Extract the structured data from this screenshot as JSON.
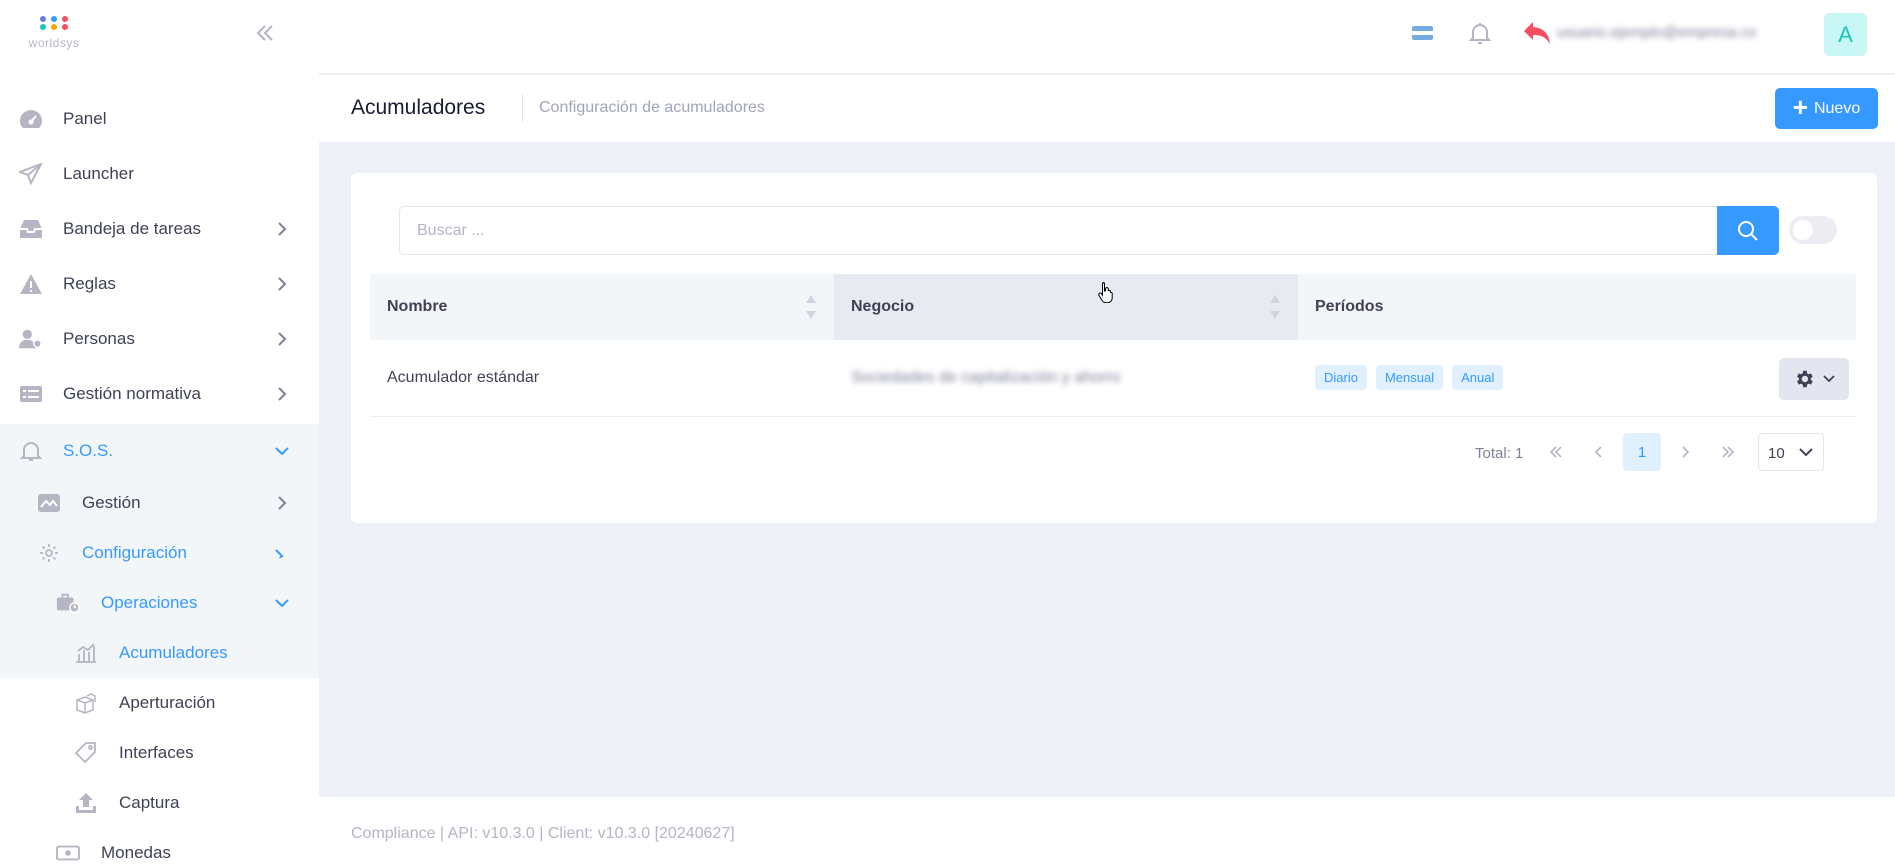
{
  "app": {
    "logo_text": "worldsys",
    "logo_colors": [
      "#6c7ae0",
      "#3699ff",
      "#f64e60",
      "#1bc5bd",
      "#ffa800"
    ]
  },
  "sidebar": {
    "items": [
      {
        "label": "Panel",
        "icon": "gauge-icon"
      },
      {
        "label": "Launcher",
        "icon": "paper-plane-icon"
      },
      {
        "label": "Bandeja de tareas",
        "icon": "inbox-tray-icon"
      },
      {
        "label": "Reglas",
        "icon": "warning-icon"
      },
      {
        "label": "Personas",
        "icon": "user-gear-icon"
      },
      {
        "label": "Gestión normativa",
        "icon": "list-alt-icon"
      },
      {
        "label": "S.O.S.",
        "icon": "bell-icon"
      },
      {
        "label": "Gestión",
        "icon": "chart-image-icon"
      },
      {
        "label": "Configuración",
        "icon": "gear-icon"
      },
      {
        "label": "Operaciones",
        "icon": "briefcase-clock-icon"
      },
      {
        "label": "Acumuladores",
        "icon": "bar-chart-icon"
      },
      {
        "label": "Aperturación",
        "icon": "boxes-icon"
      },
      {
        "label": "Interfaces",
        "icon": "tag-icon"
      },
      {
        "label": "Captura",
        "icon": "upload-icon"
      },
      {
        "label": "Monedas",
        "icon": "money-icon"
      }
    ]
  },
  "topbar": {
    "user_name": "usuario.ejemplo@empresa.com.ar",
    "avatar_letter": "A"
  },
  "subheader": {
    "title": "Acumuladores",
    "subtitle": "Configuración de acumuladores",
    "new_button": "Nuevo"
  },
  "search": {
    "placeholder": "Buscar ...",
    "value": ""
  },
  "table": {
    "headers": [
      "Nombre",
      "Negocio",
      "Períodos"
    ],
    "rows": [
      {
        "nombre": "Acumulador estándar",
        "negocio": "Sociedades de capitalización y ahorro",
        "periodos": [
          "Diario",
          "Mensual",
          "Anual"
        ]
      }
    ]
  },
  "pagination": {
    "total_label": "Total: 1",
    "current_page": "1",
    "page_size": "10"
  },
  "footer": {
    "text": "Compliance | API: v10.3.0 | Client: v10.3.0 [20240627]"
  },
  "colors": {
    "accent": "#3699ff",
    "return_arrow": "#f64e60"
  }
}
